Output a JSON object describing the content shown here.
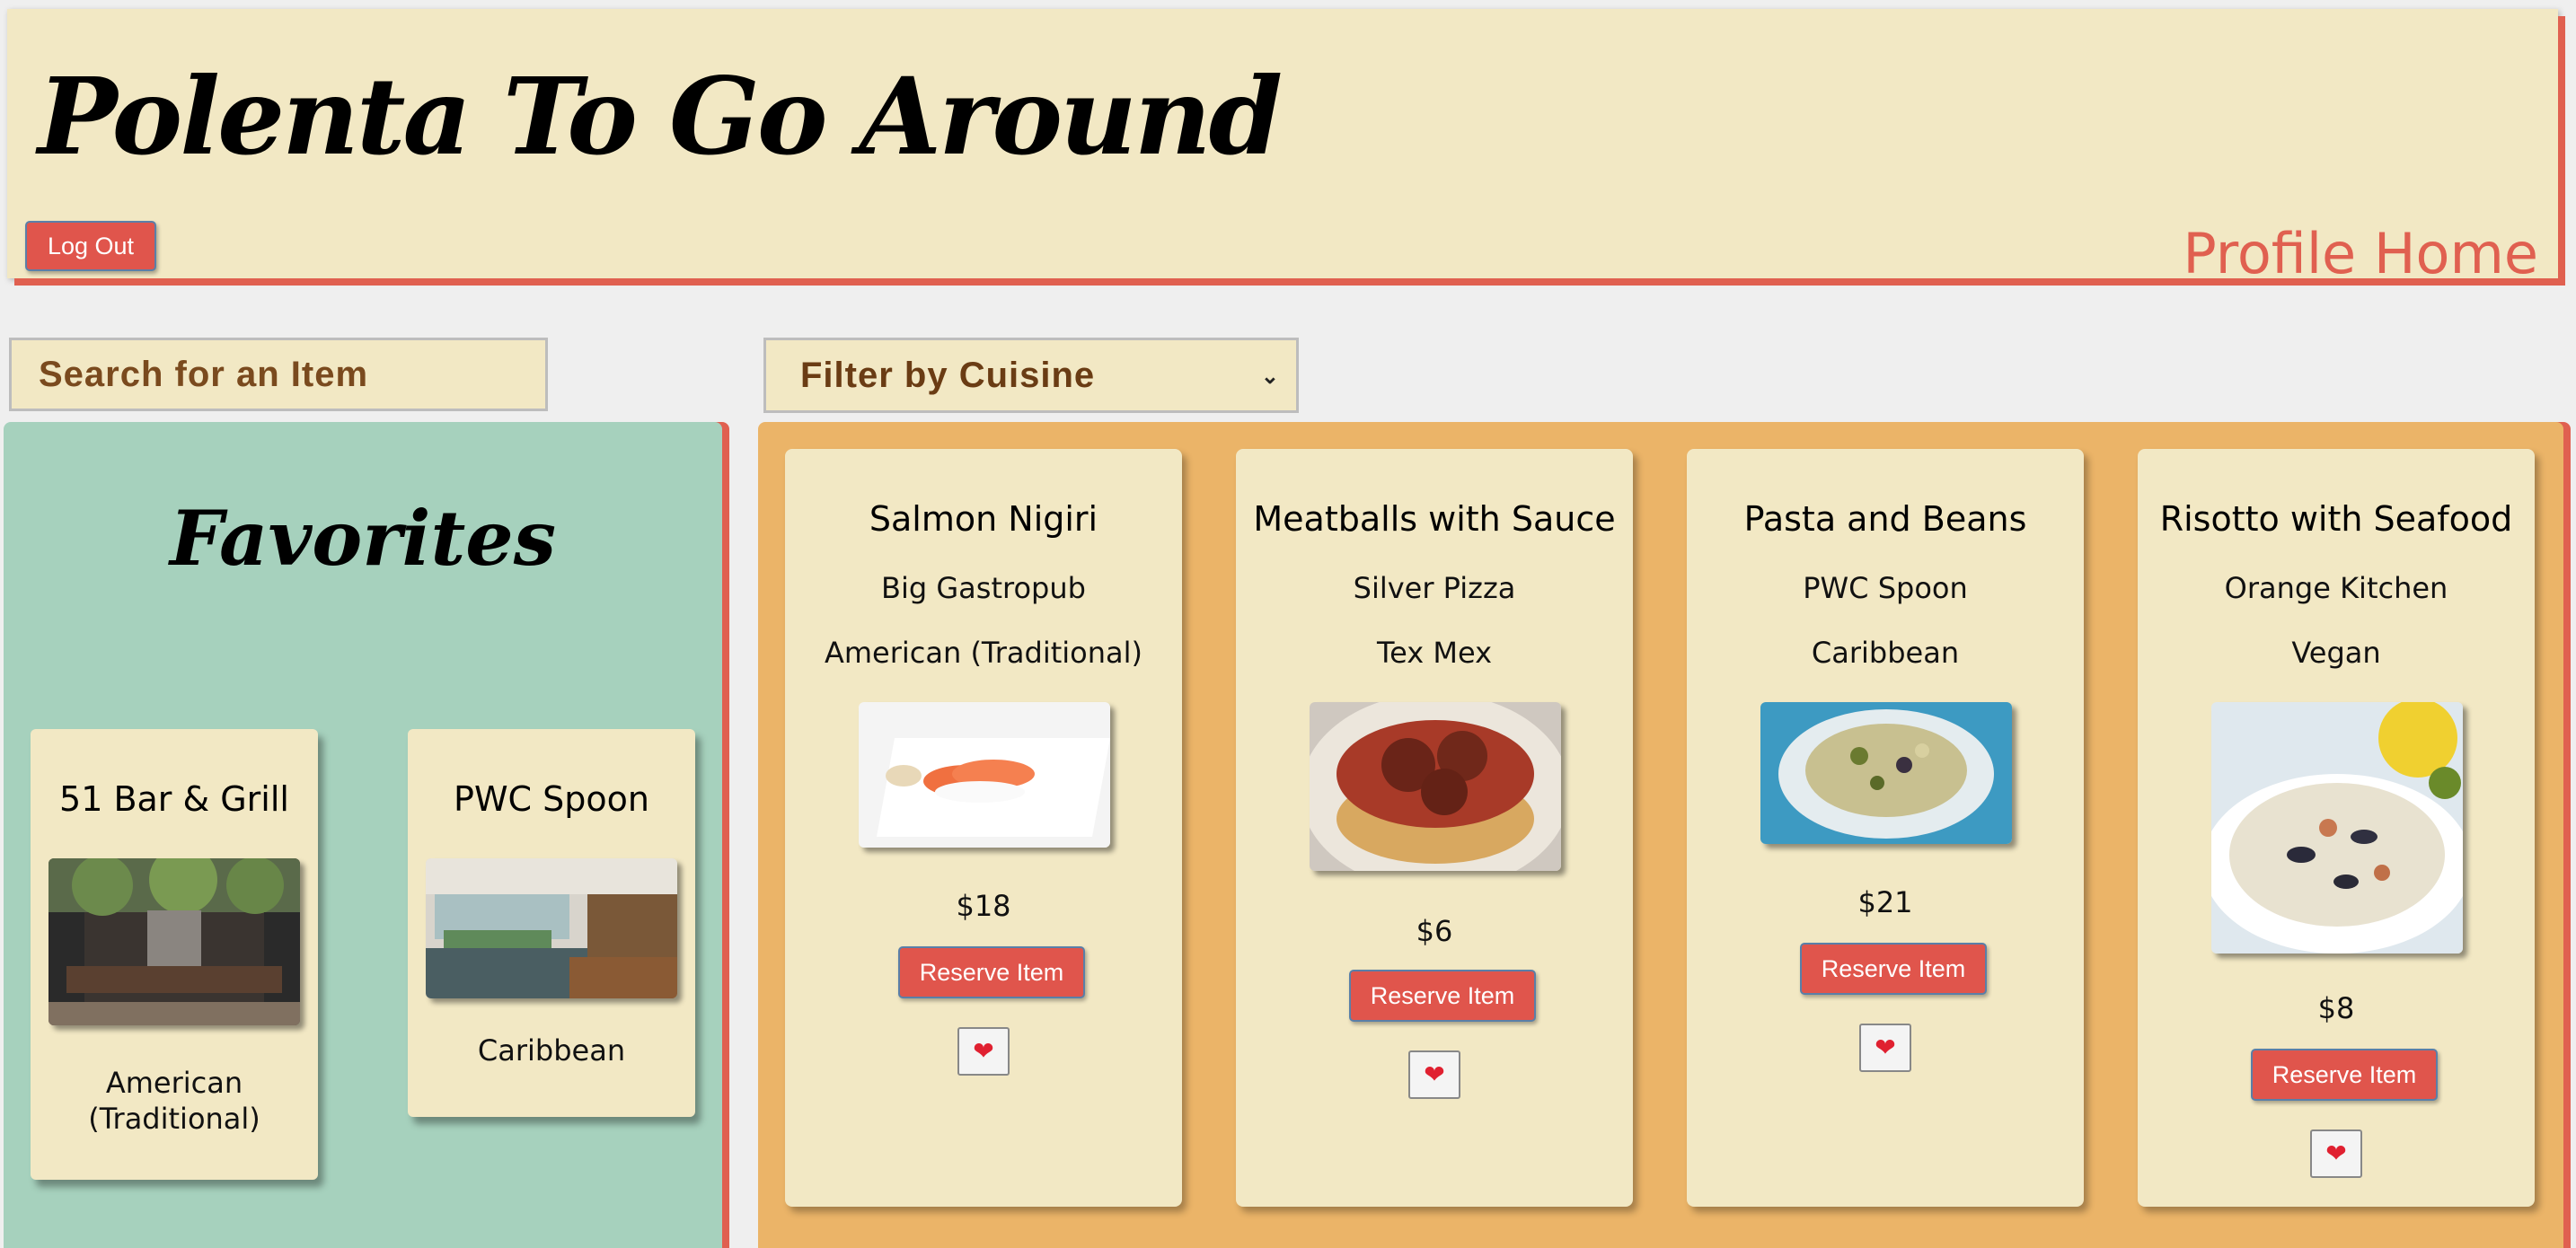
{
  "header": {
    "title": "Polenta To Go Around",
    "logout_label": "Log Out",
    "profile_home_label": "Profile Home"
  },
  "search": {
    "placeholder": "Search for an Item"
  },
  "filter": {
    "selected": "Filter by Cuisine"
  },
  "favorites": {
    "title": "Favorites",
    "cards": [
      {
        "name": "51 Bar & Grill",
        "cuisine": "American (Traditional)"
      },
      {
        "name": "PWC Spoon",
        "cuisine": "Caribbean"
      }
    ]
  },
  "menu": {
    "items": [
      {
        "name": "Salmon Nigiri",
        "restaurant": "Big Gastropub",
        "cuisine": "American (Traditional)",
        "price": "$18",
        "reserve_label": "Reserve Item",
        "favorite_icon": "heart-icon"
      },
      {
        "name": "Meatballs with Sauce",
        "restaurant": "Silver Pizza",
        "cuisine": "Tex Mex",
        "price": "$6",
        "reserve_label": "Reserve Item",
        "favorite_icon": "heart-icon"
      },
      {
        "name": "Pasta and Beans",
        "restaurant": "PWC Spoon",
        "cuisine": "Caribbean",
        "price": "$21",
        "reserve_label": "Reserve Item",
        "favorite_icon": "heart-icon"
      },
      {
        "name": "Risotto with Seafood",
        "restaurant": "Orange Kitchen",
        "cuisine": "Vegan",
        "price": "$8",
        "reserve_label": "Reserve Item",
        "favorite_icon": "heart-icon"
      }
    ]
  },
  "colors": {
    "header_bg": "#f2e8c4",
    "accent_red": "#e0554c",
    "favorites_bg": "#a6d1bd",
    "menu_bg": "#ebb468"
  }
}
